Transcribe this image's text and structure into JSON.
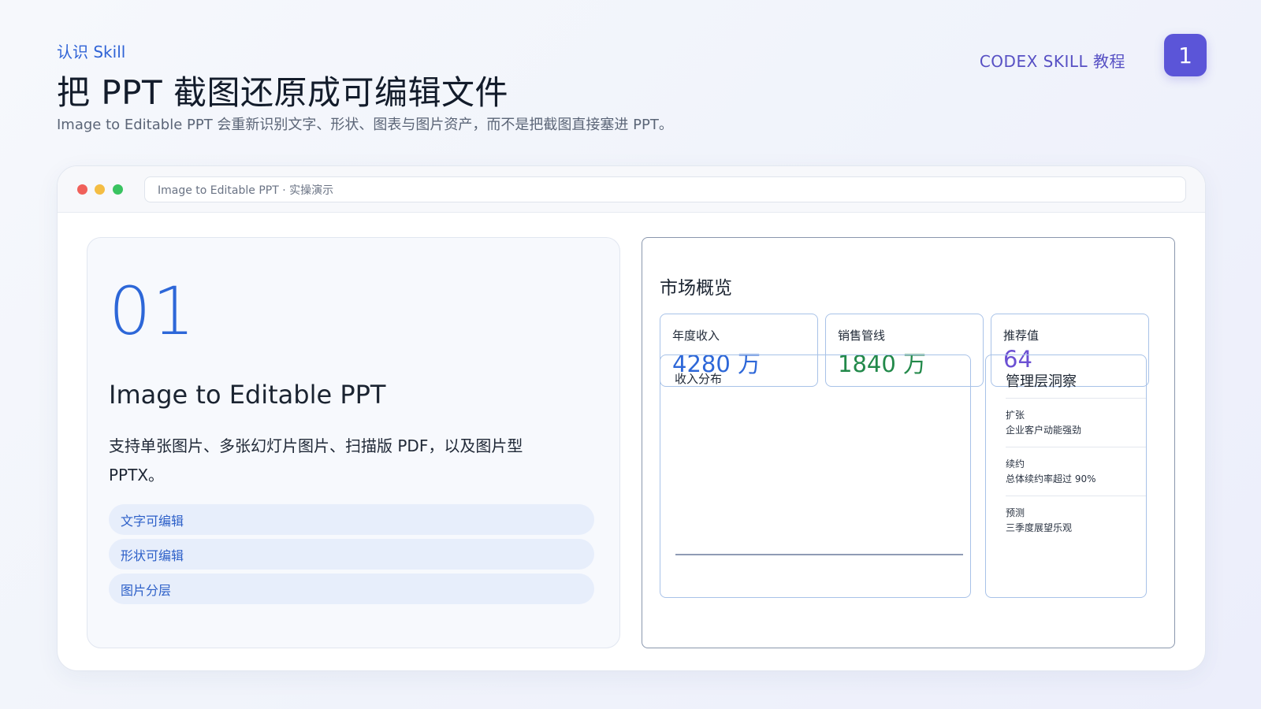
{
  "header": {
    "eyebrow": "认识 Skill",
    "title": "把 PPT 截图还原成可编辑文件",
    "subtitle": "Image to Editable PPT 会重新识别文字、形状、图表与图片资产，而不是把截图直接塞进 PPT。",
    "brand": "CODEX SKILL 教程",
    "page_number": "1"
  },
  "window": {
    "address": "Image to Editable PPT · 实操演示"
  },
  "left": {
    "number": "01",
    "title": "Image to Editable PPT",
    "description": "支持单张图片、多张幻灯片图片、扫描版 PDF，以及图片型 PPTX。",
    "pills": [
      "文字可编辑",
      "形状可编辑",
      "图片分层"
    ]
  },
  "right": {
    "title": "市场概览",
    "kpis": [
      {
        "label": "年度收入",
        "value": "4280 万",
        "color": "#2d67d8"
      },
      {
        "label": "销售管线",
        "value": "1840 万",
        "color": "#22894a"
      },
      {
        "label": "推荐值",
        "value": "64",
        "color": "#6b50d3"
      }
    ],
    "chart_panel_title": "收入分布",
    "insights_title": "管理层洞察",
    "insights": [
      {
        "key": "扩张",
        "value": "企业客户动能强劲"
      },
      {
        "key": "续约",
        "value": "总体续约率超过 90%"
      },
      {
        "key": "预测",
        "value": "三季度展望乐观"
      }
    ]
  },
  "colors": {
    "accent": "#2d67d8",
    "brand": "#5b55d8"
  }
}
